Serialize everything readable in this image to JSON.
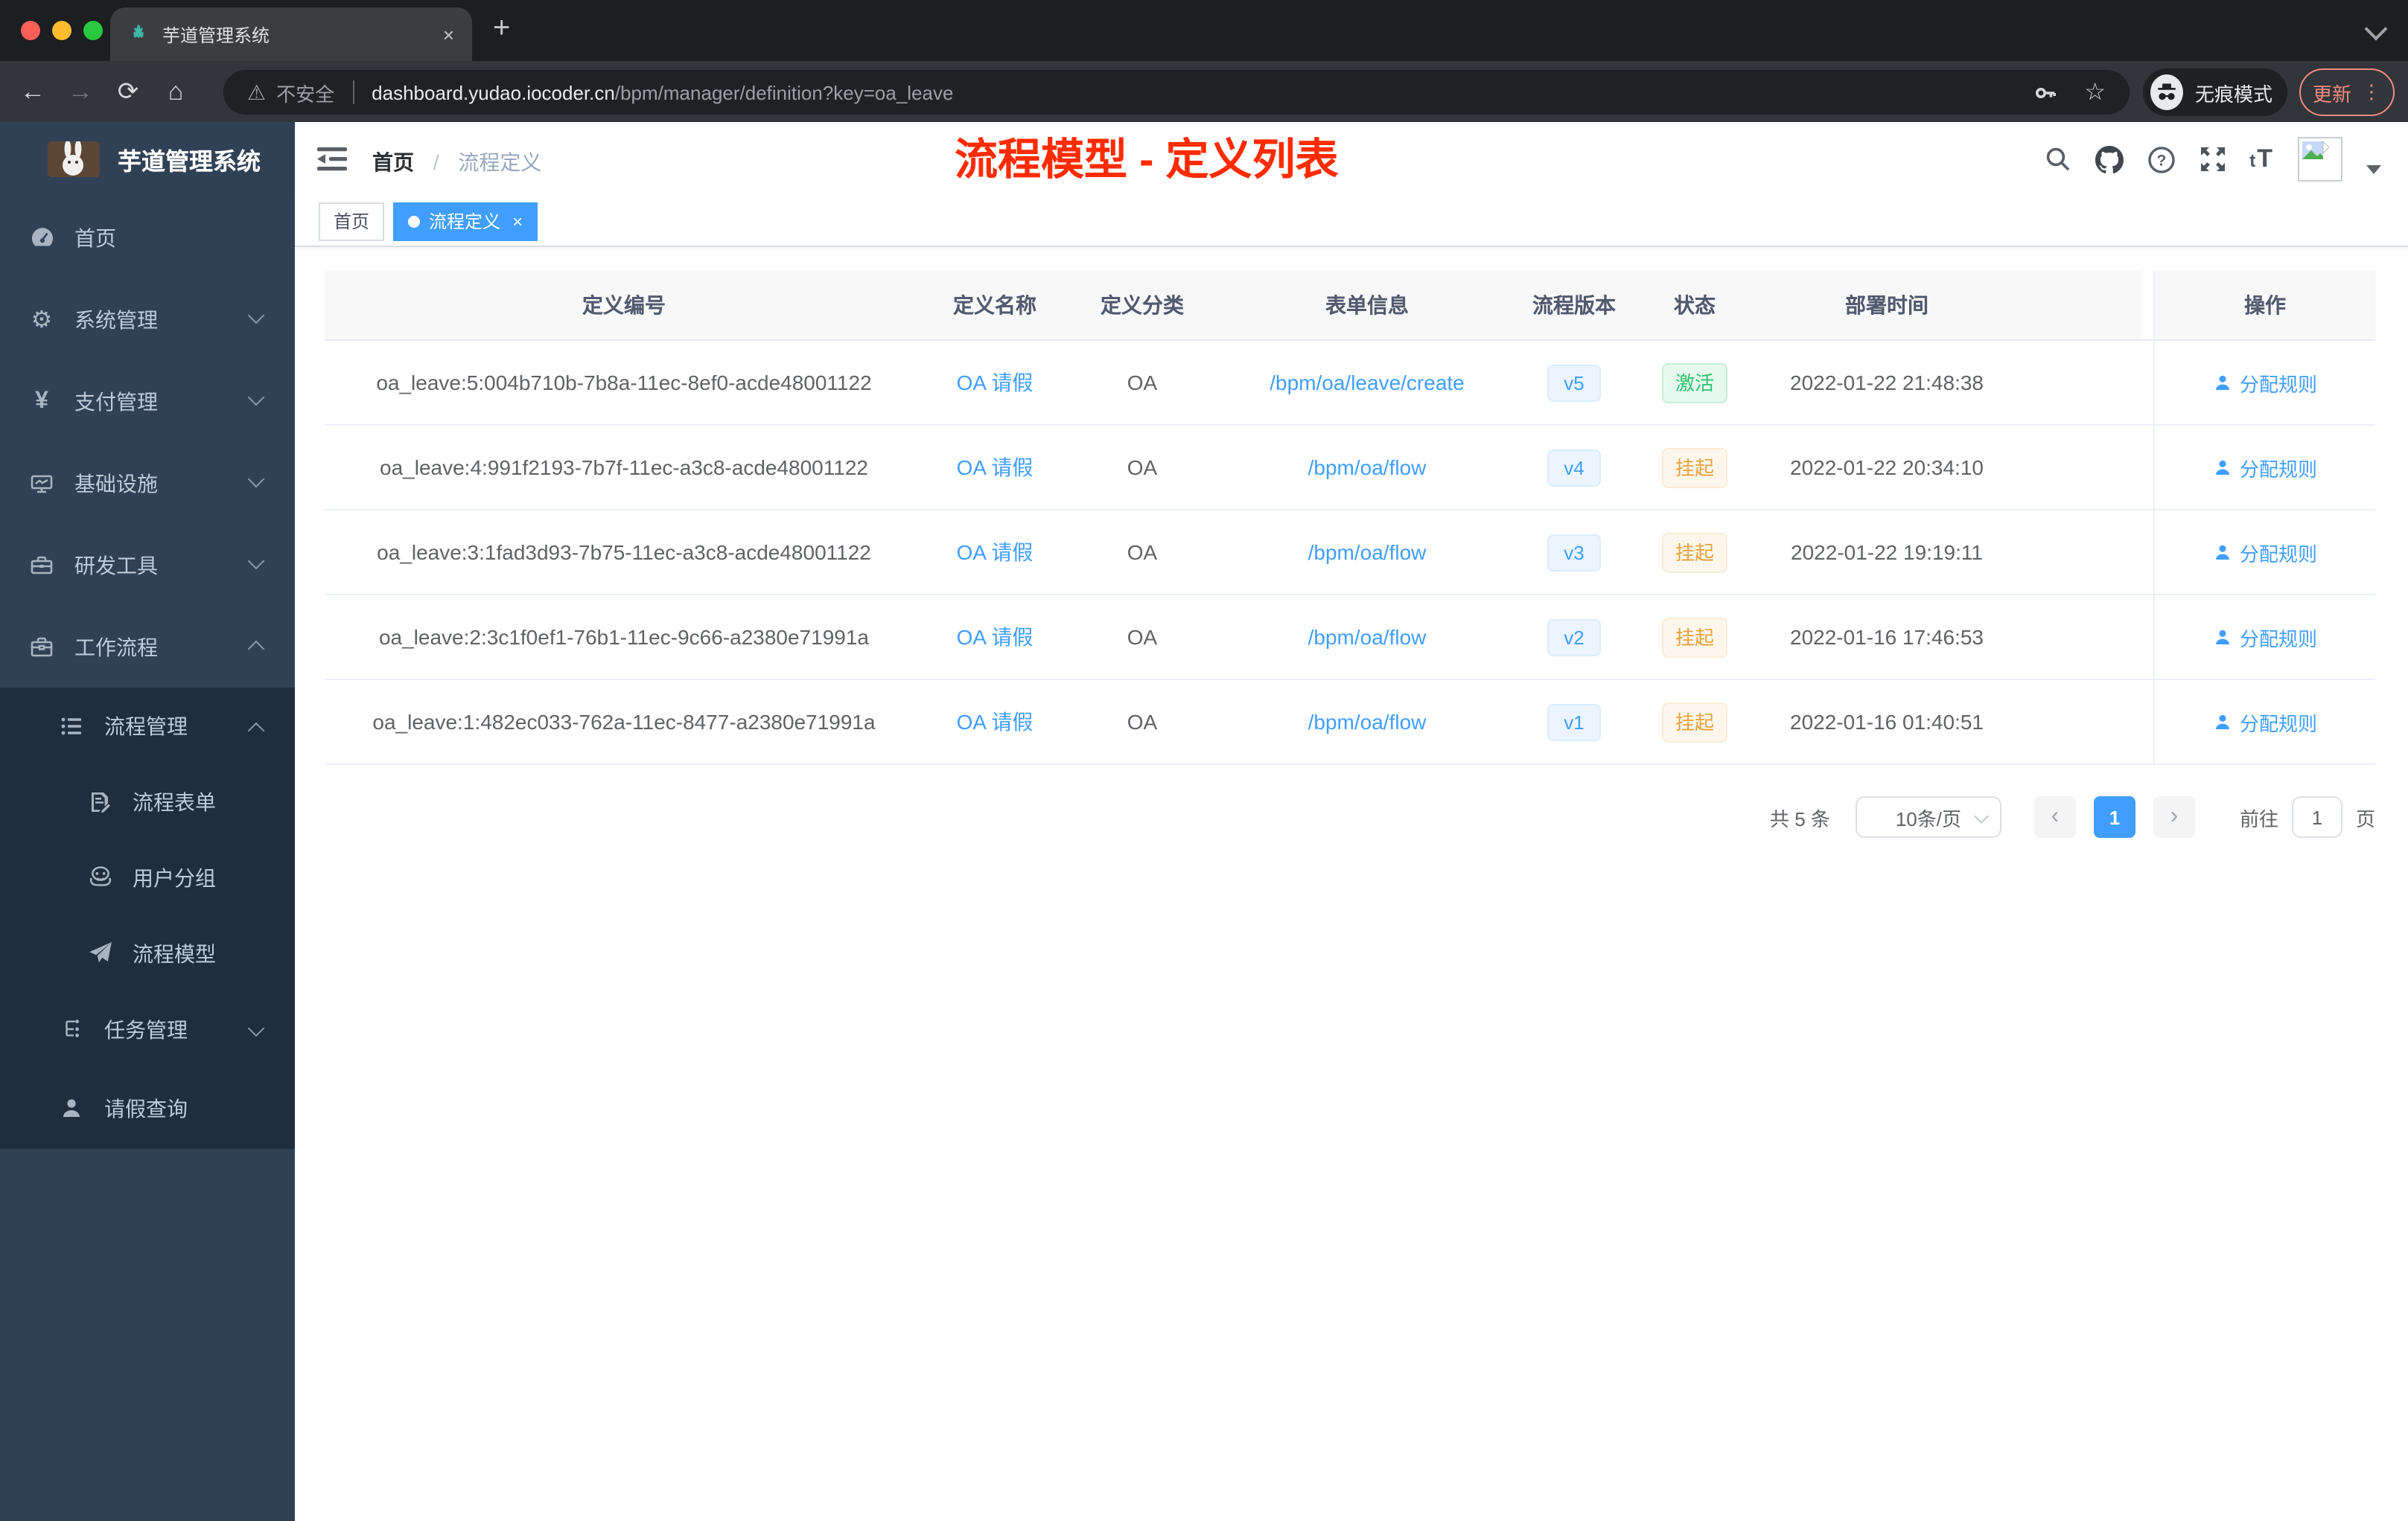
{
  "colors": {
    "accent": "#409eff",
    "annotation_red": "#ff2b00",
    "success_green": "#2dc26e",
    "warning_yellow": "#e6a23c",
    "sidebar_bg": "#304156",
    "submenu_bg": "#1f2d3d"
  },
  "browser": {
    "tab_title": "芋道管理系统",
    "tab_close": "×",
    "new_tab": "+",
    "back": "←",
    "forward": "→",
    "reload": "⟳",
    "home": "⌂",
    "warning": "⚠",
    "security_label": "不安全",
    "url_domain": "dashboard.yudao.iocoder.cn",
    "url_path": "/bpm/manager/definition?key=oa_leave",
    "star": "☆",
    "incognito_label": "无痕模式",
    "update_label": "更新",
    "menu_dots": "⋮"
  },
  "sidebar": {
    "app_title": "芋道管理系统",
    "items": [
      {
        "label": "首页"
      },
      {
        "label": "系统管理"
      },
      {
        "label": "支付管理"
      },
      {
        "label": "基础设施"
      },
      {
        "label": "研发工具"
      },
      {
        "label": "工作流程"
      },
      {
        "label": "流程管理"
      },
      {
        "label": "流程表单"
      },
      {
        "label": "用户分组"
      },
      {
        "label": "流程模型"
      },
      {
        "label": "任务管理"
      },
      {
        "label": "请假查询"
      }
    ],
    "yen_glyph": "¥"
  },
  "navbar": {
    "breadcrumb_home": "首页",
    "breadcrumb_sep": "/",
    "breadcrumb_current": "流程定义",
    "annotation": "流程模型 - 定义列表",
    "font_icon": "tT"
  },
  "tags": {
    "home": "首页",
    "active": "流程定义",
    "close": "×"
  },
  "table": {
    "columns": [
      "定义编号",
      "定义名称",
      "定义分类",
      "表单信息",
      "流程版本",
      "状态",
      "部署时间",
      "操作"
    ],
    "rows": [
      {
        "id": "oa_leave:5:004b710b-7b8a-11ec-8ef0-acde48001122",
        "name": "OA 请假",
        "category": "OA",
        "form": "/bpm/oa/leave/create",
        "version": "v5",
        "status": "激活",
        "time": "2022-01-22 21:48:38",
        "action": "分配规则"
      },
      {
        "id": "oa_leave:4:991f2193-7b7f-11ec-a3c8-acde48001122",
        "name": "OA 请假",
        "category": "OA",
        "form": "/bpm/oa/flow",
        "version": "v4",
        "status": "挂起",
        "time": "2022-01-22 20:34:10",
        "action": "分配规则"
      },
      {
        "id": "oa_leave:3:1fad3d93-7b75-11ec-a3c8-acde48001122",
        "name": "OA 请假",
        "category": "OA",
        "form": "/bpm/oa/flow",
        "version": "v3",
        "status": "挂起",
        "time": "2022-01-22 19:19:11",
        "action": "分配规则"
      },
      {
        "id": "oa_leave:2:3c1f0ef1-76b1-11ec-9c66-a2380e71991a",
        "name": "OA 请假",
        "category": "OA",
        "form": "/bpm/oa/flow",
        "version": "v2",
        "status": "挂起",
        "time": "2022-01-16 17:46:53",
        "action": "分配规则"
      },
      {
        "id": "oa_leave:1:482ec033-762a-11ec-8477-a2380e71991a",
        "name": "OA 请假",
        "category": "OA",
        "form": "/bpm/oa/flow",
        "version": "v1",
        "status": "挂起",
        "time": "2022-01-16 01:40:51",
        "action": "分配规则"
      }
    ]
  },
  "pagination": {
    "total": "共 5 条",
    "page_size": "10条/页",
    "prev": "‹",
    "current": "1",
    "next": "›",
    "goto_label": "前往",
    "goto_value": "1",
    "unit": "页"
  }
}
